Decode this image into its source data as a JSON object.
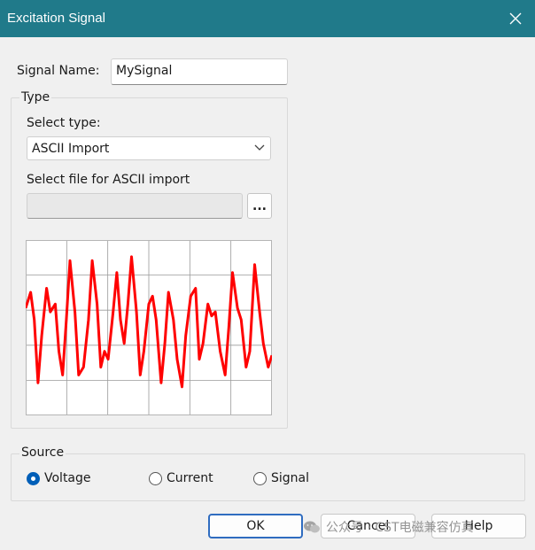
{
  "window": {
    "title": "Excitation Signal",
    "close_icon": "close-icon"
  },
  "signal_name": {
    "label": "Signal Name:",
    "value": "MySignal"
  },
  "type_group": {
    "legend": "Type",
    "select_type_label": "Select type:",
    "selected_type": "ASCII Import",
    "file_label": "Select file for ASCII import",
    "file_value": "",
    "browse_label": "..."
  },
  "source_group": {
    "legend": "Source",
    "options": [
      {
        "label": "Voltage",
        "checked": true
      },
      {
        "label": "Current",
        "checked": false
      },
      {
        "label": "Signal",
        "checked": false
      }
    ]
  },
  "buttons": {
    "ok": "OK",
    "cancel": "Cancel",
    "help": "Help"
  },
  "watermark": {
    "text": "公众号 · CST电磁兼容仿真",
    "icon": "wechat-icon"
  },
  "colors": {
    "titlebar": "#207a8a",
    "signal": "#ff0000",
    "accent": "#005fb8"
  },
  "chart_data": {
    "type": "line",
    "title": "",
    "xlabel": "",
    "ylabel": "",
    "grid": true,
    "xlim": [
      0,
      1
    ],
    "ylim": [
      -1,
      1
    ],
    "series": [
      {
        "color": "#ff0000",
        "x": [
          0,
          0.02,
          0.035,
          0.05,
          0.065,
          0.085,
          0.1,
          0.12,
          0.135,
          0.15,
          0.165,
          0.18,
          0.2,
          0.215,
          0.235,
          0.255,
          0.27,
          0.29,
          0.305,
          0.32,
          0.335,
          0.355,
          0.37,
          0.385,
          0.4,
          0.415,
          0.43,
          0.45,
          0.465,
          0.48,
          0.5,
          0.515,
          0.53,
          0.55,
          0.565,
          0.58,
          0.6,
          0.615,
          0.635,
          0.65,
          0.67,
          0.69,
          0.705,
          0.72,
          0.74,
          0.755,
          0.77,
          0.79,
          0.81,
          0.825,
          0.84,
          0.86,
          0.875,
          0.895,
          0.91,
          0.93,
          0.95,
          0.965,
          0.985,
          1.0
        ],
        "y": [
          0.25,
          0.45,
          0.1,
          -0.7,
          -0.1,
          0.5,
          0.2,
          0.3,
          -0.3,
          -0.6,
          0.1,
          0.85,
          0.2,
          -0.6,
          -0.5,
          0.1,
          0.85,
          0.3,
          -0.5,
          -0.3,
          -0.4,
          0.2,
          0.7,
          0.1,
          -0.2,
          0.3,
          0.9,
          0.2,
          -0.6,
          -0.3,
          0.3,
          0.4,
          0.1,
          -0.7,
          -0.2,
          0.45,
          0.1,
          -0.4,
          -0.75,
          -0.1,
          0.4,
          0.5,
          -0.4,
          -0.2,
          0.3,
          0.15,
          0.2,
          -0.3,
          -0.6,
          0.0,
          0.7,
          0.25,
          0.1,
          -0.5,
          -0.3,
          0.8,
          0.2,
          -0.2,
          -0.5,
          -0.35
        ]
      }
    ]
  }
}
